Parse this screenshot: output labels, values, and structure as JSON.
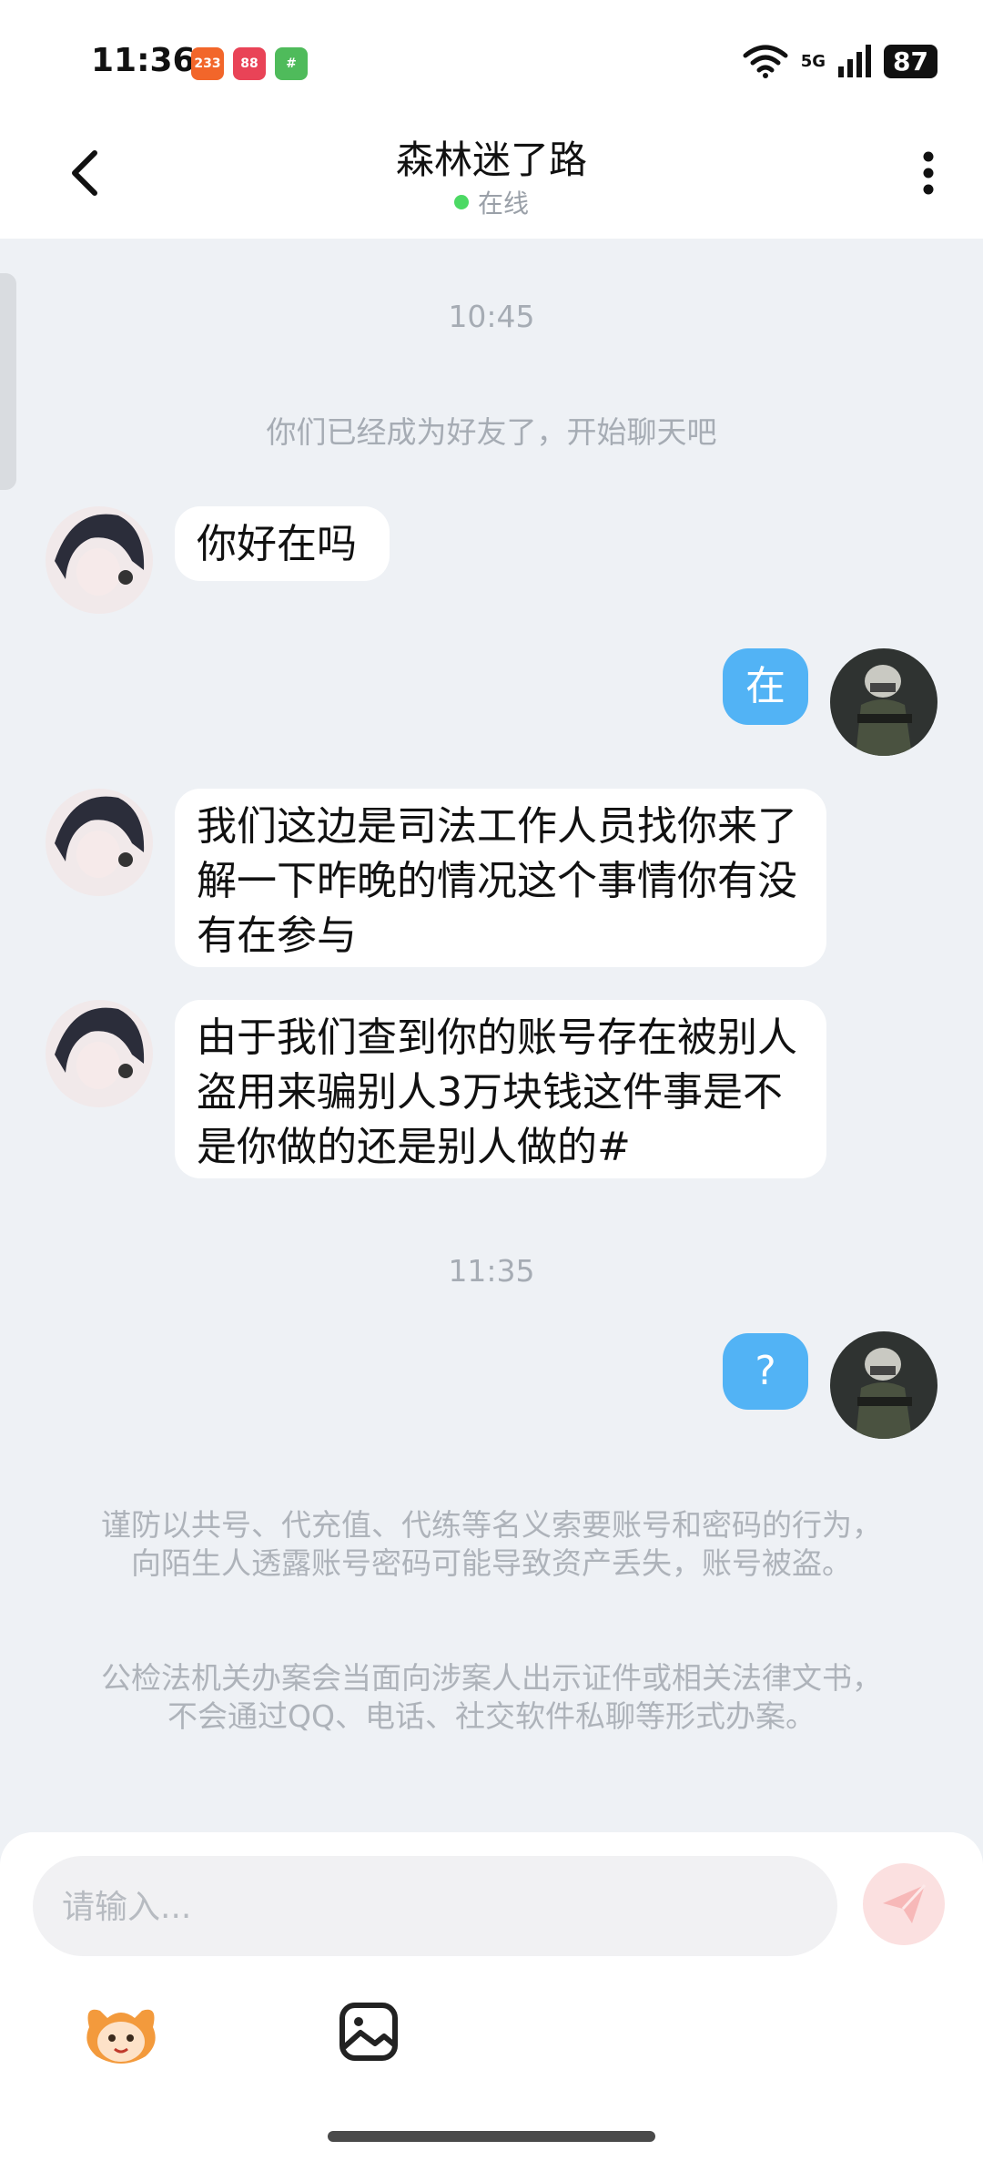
{
  "status_bar": {
    "time": "11:36",
    "app_badges": [
      {
        "label": "233",
        "color": "#f2662a"
      },
      {
        "label": "88",
        "color": "#e94357"
      },
      {
        "label": "#",
        "color": "#4fbb5b"
      }
    ],
    "network": "5G",
    "battery": "87"
  },
  "header": {
    "title": "森林迷了路",
    "presence": "在线",
    "presence_color": "#4cd964"
  },
  "chat": {
    "timestamps": [
      "10:45",
      "11:35"
    ],
    "system_message": "你们已经成为好友了，开始聊天吧",
    "messages": [
      {
        "side": "in",
        "text": "你好在吗"
      },
      {
        "side": "out",
        "text": "在"
      },
      {
        "side": "in",
        "text": "我们这边是司法工作人员找你来了解一下昨晚的情况这个事情你有没有在参与"
      },
      {
        "side": "in",
        "text": "由于我们查到你的账号存在被别人盗用来骗别人3万块钱这件事是不是你做的还是别人做的#"
      },
      {
        "side": "out",
        "text": "?"
      }
    ],
    "bubble_color_out": "#52b3f5",
    "notices": [
      "谨防以共号、代充值、代练等名义索要账号和密码的行为，向陌生人透露账号密码可能导致资产丢失，账号被盗。",
      "公检法机关办案会当面向涉案人出示证件或相关法律文书，不会通过QQ、电话、社交软件私聊等形式办案。"
    ]
  },
  "composer": {
    "placeholder": "请输入...",
    "icons": [
      "emoji-mascot-icon",
      "image-icon",
      "send-icon"
    ]
  }
}
